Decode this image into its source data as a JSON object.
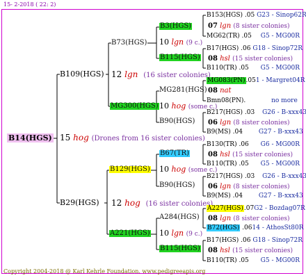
{
  "header_date": "15- 2-2018 ( 22: 2)",
  "footer": "Copyright 2004-2018 @ Karl Kehrle Foundation.   www.pedigreeapis.org",
  "colors": {
    "frame": "#d000d0",
    "highlight_pink": "#f0c0f0",
    "highlight_green": "#21d321",
    "highlight_yellow": "#ffff00",
    "highlight_cyan": "#33ccff",
    "line": "#000000",
    "red_text": "#e8002a",
    "blue_text": "#1a2ca0"
  },
  "root": {
    "name": "B14(HGS)",
    "gen_num": "15",
    "gen_word": "hog",
    "note": "(Drones from 16 sister colonies)"
  },
  "gen1": [
    {
      "name": "B109(HGS)",
      "gen_num": "12",
      "gen_word": "lgn",
      "note": "(16 sister colonies)"
    },
    {
      "name": "B29(HGS)",
      "gen_num": "12",
      "gen_word": "hog",
      "note": "(16 sister colonies)"
    }
  ],
  "gen2": [
    {
      "name": "B73(HGS)",
      "gen_num": "10",
      "gen_word": "lgn",
      "note": "(9 c.)"
    },
    {
      "name": "MG300(HGS)",
      "gen_num": "10",
      "gen_word": "hog",
      "note": "(some c.)"
    },
    {
      "name": "B129(HGS)",
      "gen_num": "10",
      "gen_word": "hog",
      "note": "(some c.)"
    },
    {
      "name": "A221(HGS)",
      "gen_num": "10",
      "gen_word": "lgn",
      "note": "(9 c.)"
    }
  ],
  "gen3": [
    {
      "name": "B3(HGS)",
      "gen_num": "07",
      "gen_word": "lgn",
      "note": "(8 sister colonies)"
    },
    {
      "name": "B115(HGS)",
      "gen_num": "08",
      "gen_word": "hsl",
      "note": "(15 sister colonies)"
    },
    {
      "name": "MG281(HGS)",
      "gen_num": "08",
      "gen_word": "nat",
      "note": ""
    },
    {
      "name": "B90(HGS)",
      "gen_num": "06",
      "gen_word": "lgn",
      "note": "(8 sister colonies)"
    },
    {
      "name": "B67(TR)",
      "gen_num": "08",
      "gen_word": "hsl",
      "note": "(15 sister colonies)"
    },
    {
      "name": "B90(HGS)",
      "gen_num": "06",
      "gen_word": "lgn",
      "note": "(8 sister colonies)"
    },
    {
      "name": "A284(HGS)",
      "gen_num": "08",
      "gen_word": "lgn",
      "note": "(8 sister colonies)"
    },
    {
      "name": "B115(HGS)",
      "gen_num": "08",
      "gen_word": "hsl",
      "note": "(15 sister colonies)"
    }
  ],
  "gen4": [
    {
      "name": "B153(HGS)",
      "year": ".05",
      "info": "G23 - Sinop62R"
    },
    {
      "name": "MG62(TR)",
      "year": ".05",
      "info": "G5 - MG00R"
    },
    {
      "name": "B17(HGS)",
      "year": ".06",
      "info": "G18 - Sinop72R"
    },
    {
      "name": "B110(TR)",
      "year": ".05",
      "info": "G5 - MG00R"
    },
    {
      "name": "MG083(PN)",
      "year": ".05",
      "info": "1 - Margret04R"
    },
    {
      "name": "Bmn08(PN)",
      "year": ".",
      "info": "no more"
    },
    {
      "name": "B217(HGS)",
      "year": ".03",
      "info": "G26 - B-xxx43"
    },
    {
      "name": "B9(MS)",
      "year": ".04",
      "info": "G27 - B-xxx43"
    },
    {
      "name": "B130(TR)",
      "year": ".06",
      "info": "G6 - MG00R"
    },
    {
      "name": "B110(TR)",
      "year": ".05",
      "info": "G5 - MG00R"
    },
    {
      "name": "B217(HGS)",
      "year": ".03",
      "info": "G26 - B-xxx43"
    },
    {
      "name": "B9(MS)",
      "year": ".04",
      "info": "G27 - B-xxx43"
    },
    {
      "name": "A227(HGS)",
      "year": ".07",
      "info": "G2 - Bozdag07R"
    },
    {
      "name": "B72(HGS)",
      "year": ".06",
      "info": "14 - AthosSt80R"
    },
    {
      "name": "B17(HGS)",
      "year": ".06",
      "info": "G18 - Sinop72R"
    },
    {
      "name": "B110(TR)",
      "year": ".05",
      "info": "G5 - MG00R"
    }
  ]
}
